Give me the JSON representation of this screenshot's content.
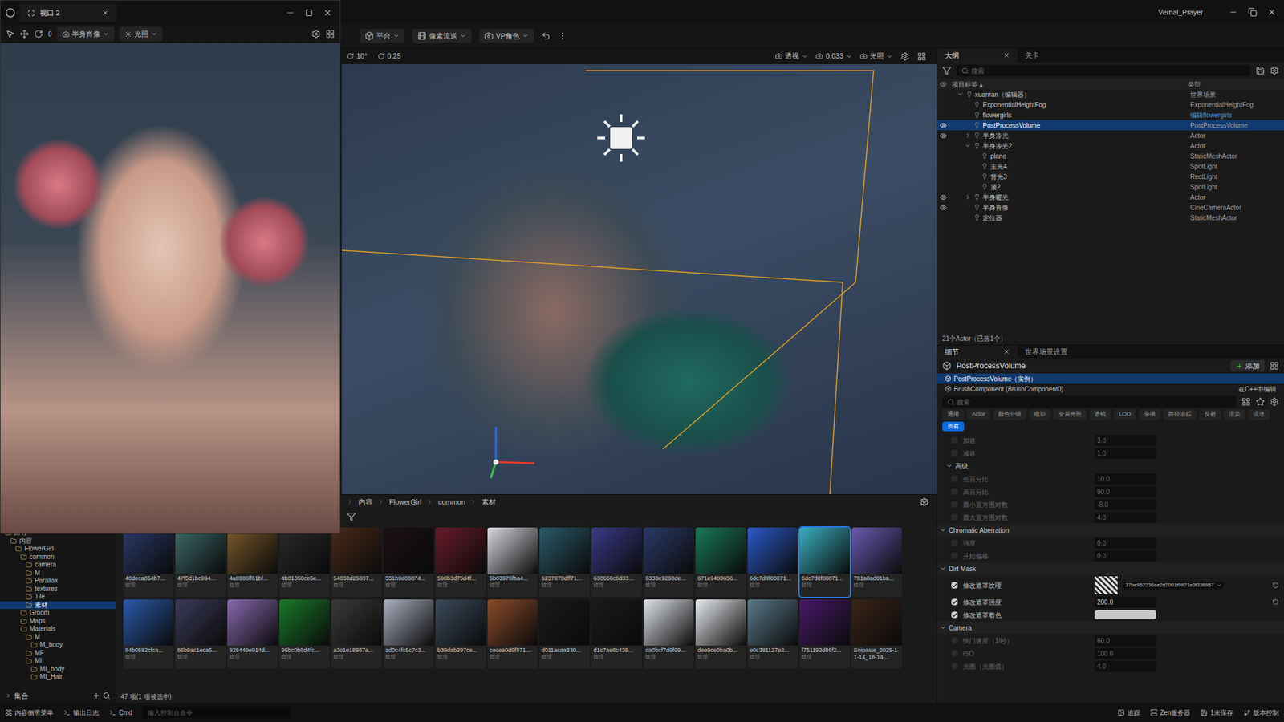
{
  "window": {
    "title": "Vernal_Prayer"
  },
  "floating_viewport": {
    "title": "视口 2",
    "toolbar": [
      "0",
      "半身肖像",
      "光照"
    ]
  },
  "main_toolbar": [
    "平台",
    "像素流送",
    "VP角色"
  ],
  "viewport_toolbar": {
    "left": [
      "10°",
      "0.25"
    ],
    "right": [
      "透视",
      "0.033",
      "光照"
    ]
  },
  "outliner": {
    "tabs": [
      {
        "label": "大纲",
        "selected": true
      },
      {
        "label": "关卡",
        "selected": false
      }
    ],
    "search": {
      "placeholder": "搜索"
    },
    "columns": [
      "项目标签 ▴",
      "类型"
    ],
    "rows": [
      {
        "name": "xuanran（编辑器）",
        "type": "世界场景",
        "indent": 1,
        "expander": "open",
        "visible": false,
        "selected": false,
        "link": false
      },
      {
        "name": "ExponentialHeightFog",
        "type": "ExponentialHeightFog",
        "indent": 2,
        "expander": "none",
        "visible": false,
        "selected": false,
        "link": false
      },
      {
        "name": "flowergirls",
        "type": "编辑flowergirls",
        "indent": 2,
        "expander": "none",
        "visible": false,
        "selected": false,
        "link": true
      },
      {
        "name": "PostProcessVolume",
        "type": "PostProcessVolume",
        "indent": 2,
        "expander": "none",
        "visible": true,
        "selected": true,
        "link": false
      },
      {
        "name": "半身冷光",
        "type": "Actor",
        "indent": 2,
        "expander": "closed",
        "visible": true,
        "selected": false,
        "link": false
      },
      {
        "name": "半身冷光2",
        "type": "Actor",
        "indent": 2,
        "expander": "open",
        "visible": false,
        "selected": false,
        "link": false
      },
      {
        "name": "plane",
        "type": "StaticMeshActor",
        "indent": 3,
        "expander": "none",
        "visible": false,
        "selected": false,
        "link": false
      },
      {
        "name": "主光4",
        "type": "SpotLight",
        "indent": 3,
        "expander": "none",
        "visible": false,
        "selected": false,
        "link": false
      },
      {
        "name": "背光3",
        "type": "RectLight",
        "indent": 3,
        "expander": "none",
        "visible": false,
        "selected": false,
        "link": false
      },
      {
        "name": "顶2",
        "type": "SpotLight",
        "indent": 3,
        "expander": "none",
        "visible": false,
        "selected": false,
        "link": false
      },
      {
        "name": "半身暖光",
        "type": "Actor",
        "indent": 2,
        "expander": "closed",
        "visible": true,
        "selected": false,
        "link": false
      },
      {
        "name": "半身肖像",
        "type": "CineCameraActor",
        "indent": 2,
        "expander": "none",
        "visible": true,
        "selected": false,
        "link": false
      },
      {
        "name": "定位器",
        "type": "StaticMeshActor",
        "indent": 2,
        "expander": "none",
        "visible": false,
        "selected": false,
        "link": false
      }
    ],
    "count": "21个Actor（已选1个）"
  },
  "details": {
    "tabs": [
      {
        "label": "细节",
        "selected": true
      },
      {
        "label": "世界场景设置",
        "selected": false
      }
    ],
    "title": "PostProcessVolume",
    "add_button": "添加",
    "components": [
      {
        "label": "PostProcessVolume（实例）",
        "note": "",
        "selected": true
      },
      {
        "label": "BrushComponent (BrushComponent0)",
        "note": "在C++中编辑",
        "selected": false
      }
    ],
    "search": {
      "placeholder": "搜索"
    },
    "filters": [
      {
        "label": "通用",
        "selected": false
      },
      {
        "label": "Actor",
        "selected": false
      },
      {
        "label": "颜色分级",
        "selected": false
      },
      {
        "label": "电影",
        "selected": false
      },
      {
        "label": "全局光照",
        "selected": false
      },
      {
        "label": "透镜",
        "selected": false
      },
      {
        "label": "LOD",
        "selected": false
      },
      {
        "label": "杂项",
        "selected": false
      },
      {
        "label": "路径追踪",
        "selected": false
      },
      {
        "label": "反射",
        "selected": false
      },
      {
        "label": "渲染",
        "selected": false
      },
      {
        "label": "流送",
        "selected": false
      },
      {
        "label": "所有",
        "selected": true
      }
    ],
    "props": [
      {
        "kind": "row",
        "label": "加速",
        "value": "3.0",
        "checked": false,
        "modified": false
      },
      {
        "kind": "row",
        "label": "减速",
        "value": "1.0",
        "checked": false,
        "modified": false
      },
      {
        "kind": "subsection",
        "label": "高级",
        "value": "",
        "checked": false,
        "modified": false
      },
      {
        "kind": "row",
        "label": "低百分比",
        "value": "10.0",
        "checked": false,
        "modified": false
      },
      {
        "kind": "row",
        "label": "高百分比",
        "value": "90.0",
        "checked": false,
        "modified": false
      },
      {
        "kind": "row",
        "label": "最小直方图对数",
        "value": "-8.0",
        "checked": false,
        "modified": false
      },
      {
        "kind": "row",
        "label": "最大直方图对数",
        "value": "4.0",
        "checked": false,
        "modified": false
      },
      {
        "kind": "section",
        "label": "Chromatic Aberration",
        "value": "",
        "checked": false,
        "modified": false
      },
      {
        "kind": "row",
        "label": "强度",
        "value": "0.0",
        "checked": false,
        "modified": false
      },
      {
        "kind": "row",
        "label": "开始偏移",
        "value": "0.0",
        "checked": false,
        "modified": false
      },
      {
        "kind": "section",
        "label": "Dirt Mask",
        "value": "",
        "checked": false,
        "modified": false
      },
      {
        "kind": "texture",
        "label": "修改遮罩纹理",
        "value": "37be952236ae2d2001f9821e3f336957",
        "checked": true,
        "modified": true
      },
      {
        "kind": "row",
        "label": "修改遮罩强度",
        "value": "200.0",
        "checked": true,
        "modified": true
      },
      {
        "kind": "color",
        "label": "修改遮罩着色",
        "value": "",
        "checked": true,
        "modified": false
      },
      {
        "kind": "section",
        "label": "Camera",
        "value": "",
        "checked": false,
        "modified": false
      },
      {
        "kind": "row",
        "label": "快门速度（1/秒）",
        "value": "60.0",
        "checked": false,
        "modified": false
      },
      {
        "kind": "row",
        "label": "ISO",
        "value": "100.0",
        "checked": false,
        "modified": false
      },
      {
        "kind": "row",
        "label": "光圈（光圈值）",
        "value": "4.0",
        "checked": false,
        "modified": false
      }
    ]
  },
  "content_browser": {
    "breadcrumb": [
      "内容",
      "FlowerGirl",
      "common",
      "素材"
    ],
    "tree": [
      {
        "label": "所有",
        "indent": 0,
        "selected": false
      },
      {
        "label": "内容",
        "indent": 1,
        "selected": false
      },
      {
        "label": "FlowerGirl",
        "indent": 2,
        "selected": false
      },
      {
        "label": "common",
        "indent": 3,
        "selected": false
      },
      {
        "label": "camera",
        "indent": 4,
        "selected": false
      },
      {
        "label": "M",
        "indent": 4,
        "selected": false
      },
      {
        "label": "Parallax",
        "indent": 4,
        "selected": false
      },
      {
        "label": "textures",
        "indent": 4,
        "selected": false
      },
      {
        "label": "Tile",
        "indent": 4,
        "selected": false
      },
      {
        "label": "素材",
        "indent": 4,
        "selected": true
      },
      {
        "label": "Groom",
        "indent": 3,
        "selected": false
      },
      {
        "label": "Maps",
        "indent": 3,
        "selected": false
      },
      {
        "label": "Materials",
        "indent": 3,
        "selected": false
      },
      {
        "label": "M",
        "indent": 4,
        "selected": false
      },
      {
        "label": "M_body",
        "indent": 5,
        "selected": false
      },
      {
        "label": "MF",
        "indent": 4,
        "selected": false
      },
      {
        "label": "MI",
        "indent": 4,
        "selected": false
      },
      {
        "label": "MI_body",
        "indent": 5,
        "selected": false
      },
      {
        "label": "MI_Hair",
        "indent": 5,
        "selected": false
      }
    ],
    "collections": "集合",
    "assets": [
      {
        "name": "40deca054b7...",
        "type": "纹理",
        "color": "#2a3a6a",
        "selected": false
      },
      {
        "name": "47f5d1bc994...",
        "type": "纹理",
        "color": "#3f6a6a",
        "selected": false
      },
      {
        "name": "4a8986ff61bf...",
        "type": "纹理",
        "color": "#7a5a2a",
        "selected": false
      },
      {
        "name": "4b01350ce5e...",
        "type": "纹理",
        "color": "#2a2a2a",
        "selected": false
      },
      {
        "name": "54833d25837...",
        "type": "纹理",
        "color": "#4a2a1a",
        "selected": false
      },
      {
        "name": "551b9d06874...",
        "type": "纹理",
        "color": "#1a1016",
        "selected": false
      },
      {
        "name": "598b3d75d4f...",
        "type": "纹理",
        "color": "#6a1a2a",
        "selected": false
      },
      {
        "name": "5b03976fba4...",
        "type": "纹理",
        "color": "#d8d8e0",
        "selected": false
      },
      {
        "name": "6237878dff71...",
        "type": "纹理",
        "color": "#2a5a6a",
        "selected": false
      },
      {
        "name": "630666c6d33...",
        "type": "纹理",
        "color": "#3a3a8a",
        "selected": false
      },
      {
        "name": "6333e9268de...",
        "type": "纹理",
        "color": "#2a3a6a",
        "selected": false
      },
      {
        "name": "671e9483656...",
        "type": "纹理",
        "color": "#1a7a5a",
        "selected": false
      },
      {
        "name": "6dc7d8f80871...",
        "type": "纹理",
        "color": "#2a5aca",
        "selected": false
      },
      {
        "name": "6dc7d8f80871...",
        "type": "纹理",
        "color": "#3ab0c0",
        "selected": true
      },
      {
        "name": "781a0ad81ba...",
        "type": "纹理",
        "color": "#6a5ab0",
        "selected": false
      },
      {
        "name": "84b0582cfca...",
        "type": "纹理",
        "color": "#2a5aaa",
        "selected": false
      },
      {
        "name": "86b9ac1eca5...",
        "type": "纹理",
        "color": "#3a3a5a",
        "selected": false
      },
      {
        "name": "928449e914d...",
        "type": "纹理",
        "color": "#8a6ab0",
        "selected": false
      },
      {
        "name": "96bc0b8d4fc...",
        "type": "纹理",
        "color": "#1a7a2a",
        "selected": false
      },
      {
        "name": "a3c1e18987a...",
        "type": "纹理",
        "color": "#3a3a3a",
        "selected": false
      },
      {
        "name": "ad0c4fc5c7c3...",
        "type": "纹理",
        "color": "#aab0c0",
        "selected": false
      },
      {
        "name": "b39dab397ce...",
        "type": "纹理",
        "color": "#3a4a5a",
        "selected": false
      },
      {
        "name": "cecea0d9f971...",
        "type": "纹理",
        "color": "#8a4a2a",
        "selected": false
      },
      {
        "name": "d011acae330...",
        "type": "纹理",
        "color": "#1a1a1a",
        "selected": false
      },
      {
        "name": "d1c7ae8c439...",
        "type": "纹理",
        "color": "#1a1a1a",
        "selected": false
      },
      {
        "name": "da0bcf7d9f09...",
        "type": "纹理",
        "color": "#e0e4ea",
        "selected": false
      },
      {
        "name": "dee9ce0ba0b...",
        "type": "纹理",
        "color": "#e8ecf0",
        "selected": false
      },
      {
        "name": "e0c381127e2...",
        "type": "纹理",
        "color": "#5a7a8a",
        "selected": false
      },
      {
        "name": "f761193d86f2...",
        "type": "纹理",
        "color": "#4a1a6a",
        "selected": false
      },
      {
        "name": "Snipaste_2025-11-14_18-14-...",
        "type": "",
        "color": "#3a2418",
        "selected": false
      }
    ],
    "count": "47 项(1 项被选中)"
  },
  "status_bar": {
    "left": [
      "内容侧滑菜单",
      "输出日志",
      "Cmd"
    ],
    "console_placeholder": "输入控制台命令",
    "right": [
      "追踪",
      "Zen服务器",
      "1未保存",
      "版本控制"
    ]
  }
}
